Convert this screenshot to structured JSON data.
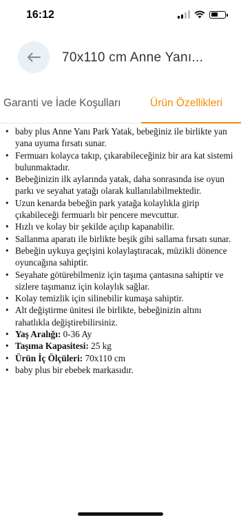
{
  "status_bar": {
    "time": "16:12"
  },
  "header": {
    "title": "70x110 cm Anne Yanı..."
  },
  "tabs": [
    {
      "label": "Garanti ve İade Koşulları"
    },
    {
      "label": "Ürün Özellikleri"
    }
  ],
  "features": [
    "baby plus Anne Yanı Park Yatak, bebeğiniz ile birlikte yan yana uyuma fırsatı sunar.",
    "Fermuarı kolayca takıp, çıkarabileceğiniz bir ara kat sistemi bulunmaktadır.",
    "Bebeğinizin ilk aylarında yatak, daha sonrasında ise oyun parkı ve seyahat yatağı olarak kullanılabilmektedir.",
    "Uzun kenarda bebeğin park yatağa kolaylıkla girip çıkabileceği fermuarlı bir pencere mevcuttur.",
    "Hızlı ve kolay bir şekilde açılıp kapanabilir.",
    "Sallanma aparatı ile birlikte beşik gibi sallama fırsatı sunar.",
    "Bebeğin uykuya geçişini kolaylaştıracak, müzikli dönence oyuncağına sahiptir.",
    "Seyahate götürebilmeniz için taşıma çantasına sahiptir ve sizlere taşımanız için kolaylık sağlar.",
    "Kolay temizlik için silinebilir kumaşa sahiptir.",
    "Alt değiştirme ünitesi ile birlikte, bebeğinizin altını rahatlıkla değiştirebilirsiniz."
  ],
  "specs": [
    {
      "label": "Yaş Aralığı:",
      "value": "0-36 Ay"
    },
    {
      "label": "Taşıma Kapasitesi:",
      "value": "25 kg"
    },
    {
      "label": "Ürün İç Ölçüleri:",
      "value": "70x110 cm"
    }
  ],
  "footer_note": "baby plus bir ebebek markasıdır.",
  "colors": {
    "accent": "#f28c00",
    "back_button_bg": "#e9f0f6"
  }
}
